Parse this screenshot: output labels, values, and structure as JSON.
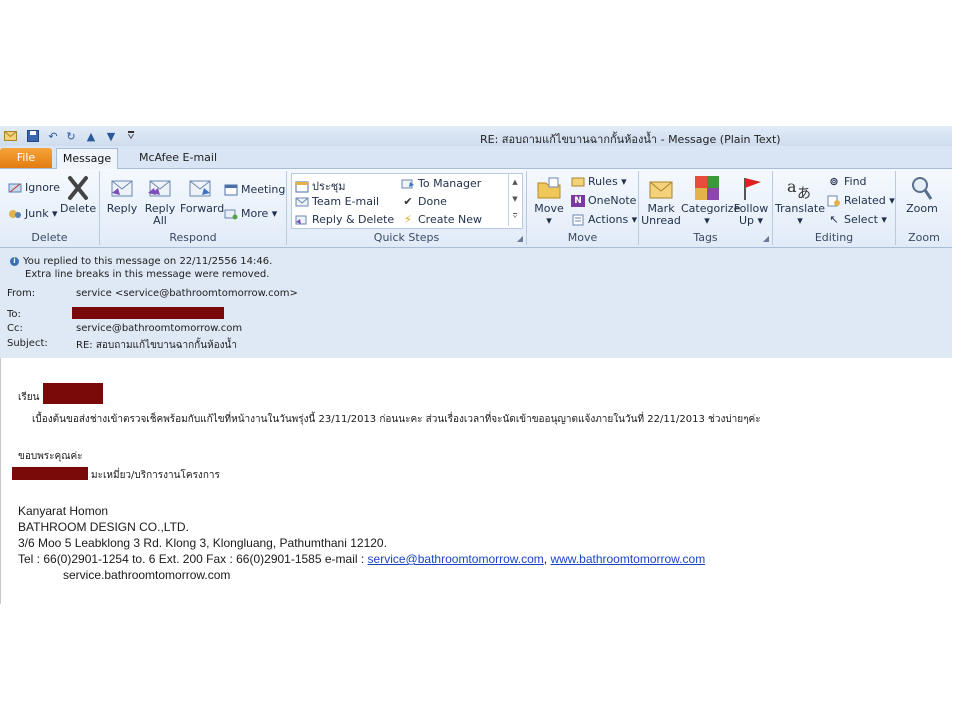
{
  "titlebar": {
    "title": "RE: สอบถามแก้ไขบานฉากกั้นห้องน้ำ  -  Message (Plain Text)",
    "qat_icons": [
      "mail-icon",
      "save-icon",
      "undo-icon",
      "redo-icon",
      "up-arrow-icon",
      "down-arrow-icon",
      "customize-icon"
    ]
  },
  "tabs": {
    "file": "File",
    "message": "Message",
    "mcafee": "McAfee E-mail Scan"
  },
  "ribbon": {
    "delete_group": {
      "label": "Delete",
      "ignore": "Ignore",
      "junk": "Junk",
      "delete": "Delete"
    },
    "respond_group": {
      "label": "Respond",
      "reply": "Reply",
      "reply_all_1": "Reply",
      "reply_all_2": "All",
      "forward": "Forward",
      "meeting": "Meeting",
      "more": "More"
    },
    "quicksteps_group": {
      "label": "Quick Steps",
      "items": [
        "ประชุม",
        "To Manager",
        "Team E-mail",
        "Done",
        "Reply & Delete",
        "Create New"
      ]
    },
    "move_group": {
      "label": "Move",
      "move": "Move",
      "rules": "Rules",
      "onenote": "OneNote",
      "actions": "Actions"
    },
    "tags_group": {
      "label": "Tags",
      "mark_unread_1": "Mark",
      "mark_unread_2": "Unread",
      "categorize": "Categorize",
      "follow_up_1": "Follow",
      "follow_up_2": "Up"
    },
    "editing_group": {
      "label": "Editing",
      "translate": "Translate",
      "find": "Find",
      "related": "Related",
      "select": "Select"
    },
    "zoom_group": {
      "label": "Zoom",
      "zoom": "Zoom"
    }
  },
  "header": {
    "info_line1": "You replied to this message on 22/11/2556 14:46.",
    "info_line2": "Extra line breaks in this message were removed.",
    "from_label": "From:",
    "from_value": "service <service@bathroomtomorrow.com>",
    "to_label": "To:",
    "cc_label": "Cc:",
    "cc_value": "service@bathroomtomorrow.com",
    "subject_label": "Subject:",
    "subject_value": "RE: สอบถามแก้ไขบานฉากกั้นห้องน้ำ"
  },
  "body": {
    "greeting": "เรียน คุ",
    "line1": "เบื้องต้นขอส่งช่างเข้าตรวจเช็คพร้อมกับแก้ไขที่หน้างานในวันพรุ่งนี้ 23/11/2013 ก่อนนะคะ ส่วนเรื่องเวลาที่จะนัดเข้าขออนุญาตแจ้งภายในวันที่ 22/11/2013 ช่วงบ่ายๆค่ะ",
    "thanks": "ขอบพระคุณค่ะ",
    "sign_role": "มะเหมี่ยว/บริการงานโครงการ",
    "name": "Kanyarat  Homon",
    "company": "BATHROOM DESIGN CO.,LTD.",
    "address": "3/6 Moo 5 Leabklong 3 Rd. Klong 3, Klongluang, Pathumthani  12120.",
    "tel_prefix": "Tel : 66(0)2901-1254 to. 6 Ext. 200 Fax : 66(0)2901-1585 e-mail : ",
    "email_link": "service@bathroomtomorrow.com",
    "comma": ", ",
    "web_link": "www.bathroomtomorrow.com",
    "site_line": "service.bathroomtomorrow.com"
  },
  "colors": {
    "redaction": "#7a0a0a",
    "file_tab": "#e8891c",
    "link": "#1a44c8"
  }
}
